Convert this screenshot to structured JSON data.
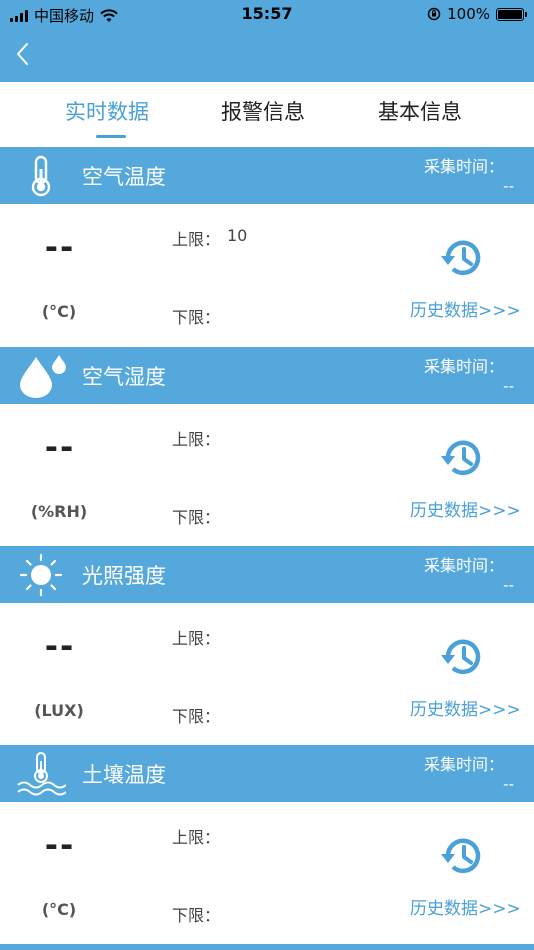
{
  "status_bar": {
    "carrier": "中国移动",
    "time": "15:57",
    "battery": "100%"
  },
  "tabs": [
    {
      "label": "实时数据",
      "active": true
    },
    {
      "label": "报警信息",
      "active": false
    },
    {
      "label": "基本信息",
      "active": false
    }
  ],
  "colors": {
    "header": "#55a8dc",
    "accent": "#4aa0d8"
  },
  "sections": [
    {
      "icon": "thermometer-icon",
      "title": "空气温度",
      "time_label": "采集时间：",
      "time_value": "--",
      "value": "--",
      "unit": "(°C)",
      "upper_label": "上限：",
      "upper_value": "10",
      "lower_label": "下限：",
      "lower_value": "",
      "history_link": "历史数据>>>"
    },
    {
      "icon": "water-drops-icon",
      "title": "空气湿度",
      "time_label": "采集时间：",
      "time_value": "--",
      "value": "--",
      "unit": "(%RH)",
      "upper_label": "上限：",
      "upper_value": "",
      "lower_label": "下限：",
      "lower_value": "",
      "history_link": "历史数据>>>"
    },
    {
      "icon": "sun-icon",
      "title": "光照强度",
      "time_label": "采集时间：",
      "time_value": "--",
      "value": "--",
      "unit": "(LUX)",
      "upper_label": "上限：",
      "upper_value": "",
      "lower_label": "下限：",
      "lower_value": "",
      "history_link": "历史数据>>>"
    },
    {
      "icon": "soil-thermometer-icon",
      "title": "土壤温度",
      "time_label": "采集时间：",
      "time_value": "--",
      "value": "--",
      "unit": "(°C)",
      "upper_label": "上限：",
      "upper_value": "",
      "lower_label": "下限：",
      "lower_value": "",
      "history_link": "历史数据>>>"
    }
  ]
}
